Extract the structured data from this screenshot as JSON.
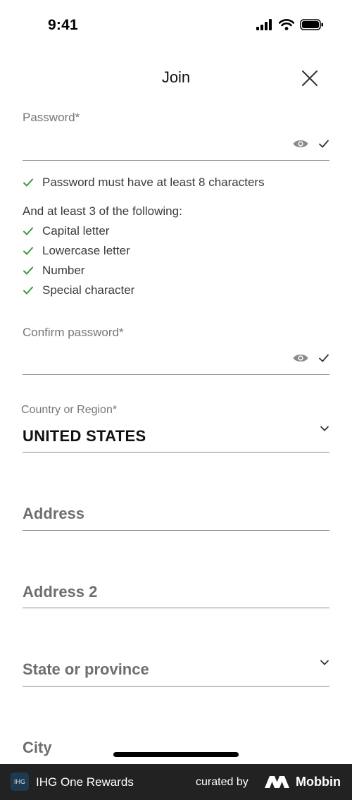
{
  "status_bar": {
    "time": "9:41"
  },
  "header": {
    "title": "Join"
  },
  "password": {
    "label": "Password*"
  },
  "rules": {
    "primary": "Password must have at least 8 characters",
    "intro": "And at least 3 of the following:",
    "items": [
      {
        "label": "Capital letter"
      },
      {
        "label": "Lowercase letter"
      },
      {
        "label": "Number"
      },
      {
        "label": "Special character"
      }
    ]
  },
  "confirm_password": {
    "label": "Confirm password*"
  },
  "country": {
    "label": "Country or Region*",
    "value": "UNITED STATES"
  },
  "address": {
    "placeholder": "Address"
  },
  "address2": {
    "placeholder": "Address 2"
  },
  "state": {
    "placeholder": "State or province"
  },
  "city": {
    "placeholder": "City"
  },
  "footer": {
    "app_name": "IHG One Rewards",
    "app_logo": "IHG",
    "curated_by": "curated by",
    "brand": "Mobbin"
  },
  "colors": {
    "check_green": "#3a9a3a",
    "footer_bg": "#222222"
  }
}
